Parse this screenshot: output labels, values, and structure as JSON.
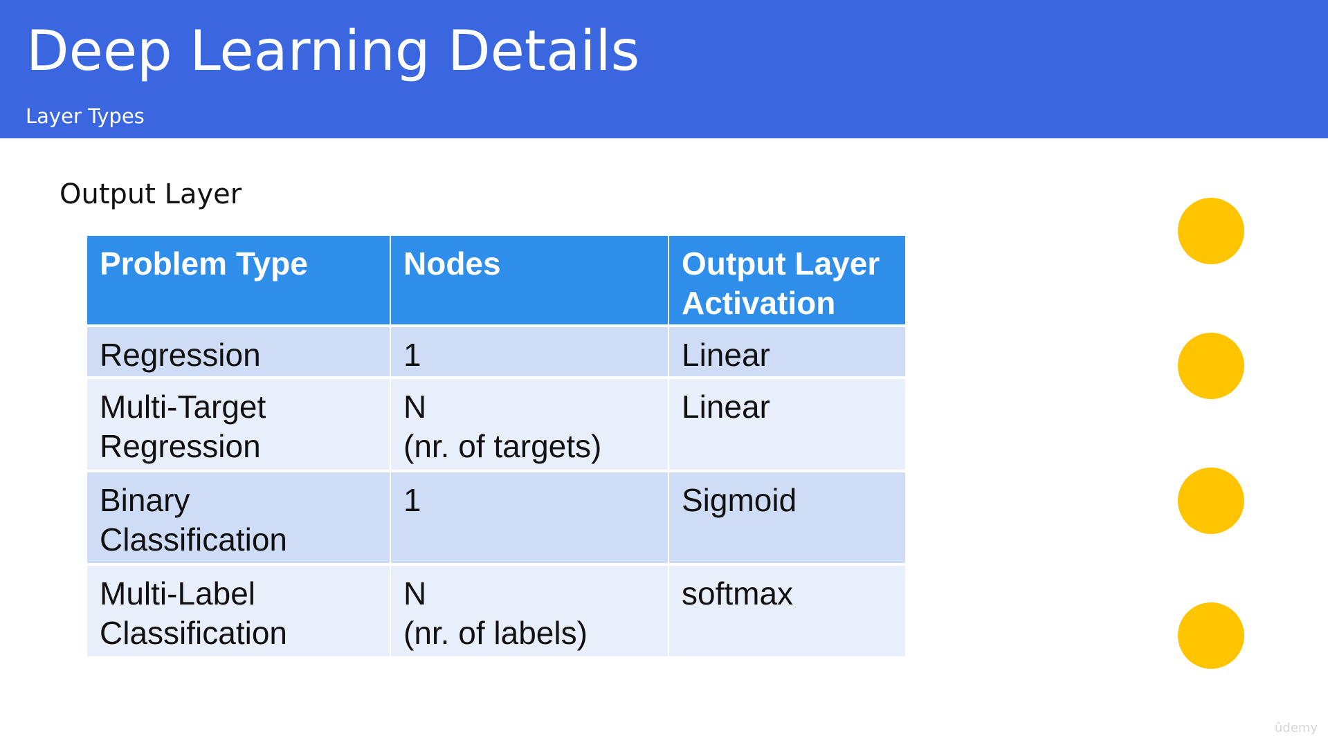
{
  "slide": {
    "title": "Deep Learning Details",
    "subtitle": "Layer Types",
    "section_heading": "Output Layer",
    "header_color": "#3a67e0"
  },
  "table": {
    "headers": [
      "Problem Type",
      "Nodes",
      "Output Layer\nActivation"
    ],
    "rows": [
      [
        "Regression",
        "1",
        "Linear"
      ],
      [
        "Multi-Target\nRegression",
        "N\n(nr. of targets)",
        "Linear"
      ],
      [
        "Binary\nClassification",
        "1",
        "Sigmoid"
      ],
      [
        "Multi-Label\nClassification",
        "N\n(nr. of labels)",
        "softmax"
      ]
    ],
    "header_color": "#2f8ee9",
    "row_colors": [
      "#cfdcf5",
      "#e8eefa"
    ]
  },
  "decorations": {
    "dot_color": "#ffc400",
    "dot_count": 4
  },
  "watermark": "ûdemy"
}
